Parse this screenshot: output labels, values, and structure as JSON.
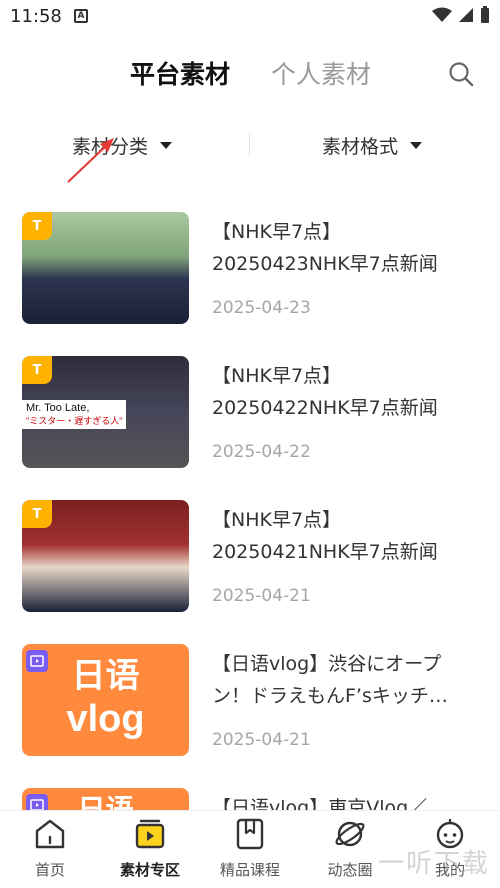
{
  "status_bar": {
    "time": "11:58",
    "notification_icon": "A"
  },
  "top_tabs": {
    "active": "平台素材",
    "inactive": "个人素材"
  },
  "filters": {
    "category_label": "素材分类",
    "format_label": "素材格式"
  },
  "items": [
    {
      "title_line1": "【NHK早7点】",
      "title_line2": "20250423NHK早7点新闻",
      "date": "2025-04-23",
      "badge": "T",
      "thumb": "photo"
    },
    {
      "title_line1": "【NHK早7点】",
      "title_line2": "20250422NHK早7点新闻",
      "date": "2025-04-22",
      "badge": "T",
      "thumb": "photo",
      "caption1": "Mr. Too Late,",
      "caption2": "\"ミスター・遅すぎる人\""
    },
    {
      "title_line1": "【NHK早7点】",
      "title_line2": "20250421NHK早7点新闻",
      "date": "2025-04-21",
      "badge": "T",
      "thumb": "photo"
    },
    {
      "title_line1": "【日语vlog】渋谷にオープ",
      "title_line2": "ン！ドラえもんF’sキッチ…",
      "date": "2025-04-21",
      "thumb": "vlog",
      "thumb_top": "日语",
      "thumb_bottom": "vlog"
    },
    {
      "title_line1": "【日语vlog】東京Vlog／",
      "title_line2": "",
      "date": "",
      "thumb": "vlog",
      "thumb_top": "日语",
      "thumb_bottom": ""
    }
  ],
  "bottom_nav": [
    {
      "label": "首页",
      "icon": "home-icon"
    },
    {
      "label": "素材专区",
      "icon": "material-icon",
      "active": true
    },
    {
      "label": "精品课程",
      "icon": "bookmark-book-icon"
    },
    {
      "label": "动态圈",
      "icon": "planet-icon"
    },
    {
      "label": "我的",
      "icon": "robot-face-icon"
    }
  ],
  "watermark": "一听下载",
  "colors": {
    "accent": "#ffd21e",
    "vlog_orange": "#ff8a3d",
    "badge_yellow": "#ffb300",
    "badge_purple": "#7a5cf0"
  }
}
